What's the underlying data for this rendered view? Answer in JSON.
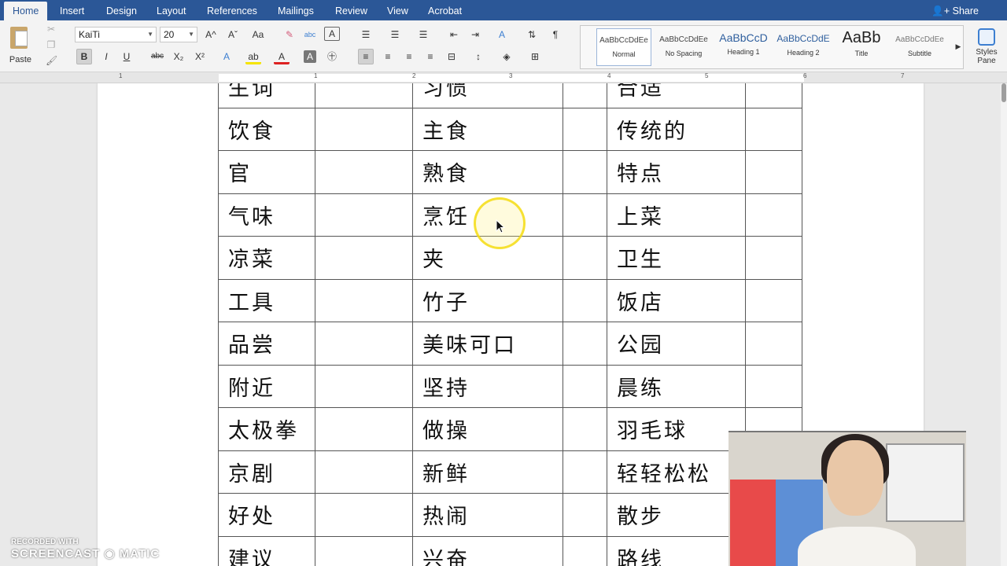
{
  "ribbon_tabs": [
    "Home",
    "Insert",
    "Design",
    "Layout",
    "References",
    "Mailings",
    "Review",
    "View",
    "Acrobat"
  ],
  "active_tab": "Home",
  "share_label": "Share",
  "clipboard": {
    "paste_label": "Paste"
  },
  "font": {
    "name": "KaiTi",
    "size": "20"
  },
  "format_buttons": {
    "bold": "B",
    "italic": "I",
    "underline": "U",
    "strike": "abc",
    "subscript": "X₂",
    "superscript": "X²"
  },
  "styles": [
    {
      "sample": "AaBbCcDdEe",
      "name": "Normal",
      "selected": true
    },
    {
      "sample": "AaBbCcDdEe",
      "name": "No Spacing"
    },
    {
      "sample": "AaBbCcD",
      "name": "Heading 1"
    },
    {
      "sample": "AaBbCcDdE",
      "name": "Heading 2"
    },
    {
      "sample": "AaBb",
      "name": "Title"
    },
    {
      "sample": "AaBbCcDdEe",
      "name": "Subtitle"
    }
  ],
  "styles_pane_label": [
    "Styles",
    "Pane"
  ],
  "ruler_numbers": [
    "1",
    "1",
    "2",
    "3",
    "4",
    "5",
    "6",
    "7"
  ],
  "vocab_table": [
    [
      "生词",
      "习惯",
      "合适"
    ],
    [
      "饮食",
      "主食",
      "传统的"
    ],
    [
      "官",
      "熟食",
      "特点"
    ],
    [
      "气味",
      "烹饪",
      "上菜"
    ],
    [
      "凉菜",
      "夹",
      "卫生"
    ],
    [
      "工具",
      "竹子",
      "饭店"
    ],
    [
      "品尝",
      "美味可口",
      "公园"
    ],
    [
      "附近",
      "坚持",
      "晨练"
    ],
    [
      "太极拳",
      "做操",
      "羽毛球"
    ],
    [
      "京剧",
      "新鲜",
      "轻轻松松"
    ],
    [
      "好处",
      "热闹",
      "散步"
    ],
    [
      "建议",
      "兴奋",
      "路线"
    ]
  ],
  "watermark": {
    "line1": "RECORDED WITH",
    "line2": "SCREENCAST",
    "line3": "MATIC"
  },
  "colors": {
    "ribbon_blue": "#2b5797",
    "ribbon_bg": "#f3f3f3",
    "cursor_highlight": "#f5dc14"
  }
}
